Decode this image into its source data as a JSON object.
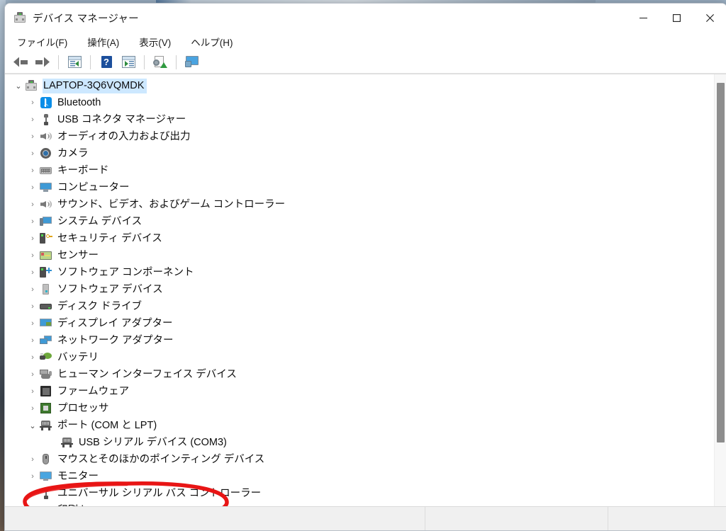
{
  "window": {
    "title": "デバイス マネージャー",
    "icon": "device-manager-icon",
    "controls": {
      "minimize": "—",
      "maximize": "□",
      "close": "✕"
    }
  },
  "menubar": {
    "items": [
      {
        "label": "ファイル(F)",
        "name": "menu-file"
      },
      {
        "label": "操作(A)",
        "name": "menu-action"
      },
      {
        "label": "表示(V)",
        "name": "menu-view"
      },
      {
        "label": "ヘルプ(H)",
        "name": "menu-help"
      }
    ]
  },
  "toolbar": {
    "buttons": [
      {
        "name": "back-button",
        "icon": "back-arrow-icon"
      },
      {
        "name": "forward-button",
        "icon": "forward-arrow-icon"
      },
      {
        "name": "show-hide-console-tree-button",
        "icon": "console-tree-icon"
      },
      {
        "name": "help-button",
        "icon": "help-question-icon"
      },
      {
        "name": "properties-button",
        "icon": "properties-pane-icon"
      },
      {
        "name": "scan-hardware-changes-button",
        "icon": "scan-hardware-icon"
      },
      {
        "name": "update-driver-button",
        "icon": "monitor-update-icon"
      }
    ]
  },
  "tree": {
    "root": {
      "label": "LAPTOP-3Q6VQMDK",
      "icon": "computer-root-icon",
      "expanded": true,
      "selected": true
    },
    "nodes": [
      {
        "label": "Bluetooth",
        "icon": "bluetooth-icon",
        "level": 1,
        "expanded": false
      },
      {
        "label": "USB コネクタ マネージャー",
        "icon": "usb-icon",
        "level": 1,
        "expanded": false
      },
      {
        "label": "オーディオの入力および出力",
        "icon": "speaker-icon",
        "level": 1,
        "expanded": false
      },
      {
        "label": "カメラ",
        "icon": "camera-icon",
        "level": 1,
        "expanded": false
      },
      {
        "label": "キーボード",
        "icon": "keyboard-icon",
        "level": 1,
        "expanded": false
      },
      {
        "label": "コンピューター",
        "icon": "computer-icon",
        "level": 1,
        "expanded": false
      },
      {
        "label": "サウンド、ビデオ、およびゲーム コントローラー",
        "icon": "speaker-icon",
        "level": 1,
        "expanded": false
      },
      {
        "label": "システム デバイス",
        "icon": "system-device-icon",
        "level": 1,
        "expanded": false
      },
      {
        "label": "セキュリティ デバイス",
        "icon": "security-device-icon",
        "level": 1,
        "expanded": false
      },
      {
        "label": "センサー",
        "icon": "sensor-icon",
        "level": 1,
        "expanded": false
      },
      {
        "label": "ソフトウェア コンポーネント",
        "icon": "software-component-icon",
        "level": 1,
        "expanded": false
      },
      {
        "label": "ソフトウェア デバイス",
        "icon": "software-device-icon",
        "level": 1,
        "expanded": false
      },
      {
        "label": "ディスク ドライブ",
        "icon": "disk-drive-icon",
        "level": 1,
        "expanded": false
      },
      {
        "label": "ディスプレイ アダプター",
        "icon": "display-adapter-icon",
        "level": 1,
        "expanded": false
      },
      {
        "label": "ネットワーク アダプター",
        "icon": "network-adapter-icon",
        "level": 1,
        "expanded": false
      },
      {
        "label": "バッテリ",
        "icon": "battery-icon",
        "level": 1,
        "expanded": false
      },
      {
        "label": "ヒューマン インターフェイス デバイス",
        "icon": "hid-icon",
        "level": 1,
        "expanded": false
      },
      {
        "label": "ファームウェア",
        "icon": "firmware-icon",
        "level": 1,
        "expanded": false
      },
      {
        "label": "プロセッサ",
        "icon": "processor-icon",
        "level": 1,
        "expanded": false
      },
      {
        "label": "ポート (COM と LPT)",
        "icon": "port-icon",
        "level": 1,
        "expanded": true,
        "highlighted": true
      },
      {
        "label": "USB シリアル デバイス (COM3)",
        "icon": "port-icon",
        "level": 2,
        "expanded": false,
        "highlighted": true
      },
      {
        "label": "マウスとそのほかのポインティング デバイス",
        "icon": "mouse-icon",
        "level": 1,
        "expanded": false
      },
      {
        "label": "モニター",
        "icon": "monitor-icon",
        "level": 1,
        "expanded": false
      },
      {
        "label": "ユニバーサル シリアル バス コントローラー",
        "icon": "usb-icon",
        "level": 1,
        "expanded": false
      },
      {
        "label": "印刷キュー",
        "icon": "printer-icon",
        "level": 1,
        "expanded": false
      }
    ]
  },
  "annotation": {
    "type": "hand-drawn-ellipse",
    "color": "#e81515",
    "targets": [
      "ポート (COM と LPT)",
      "USB シリアル デバイス (COM3)"
    ]
  },
  "statusbar": {
    "pane1": "",
    "pane2": "",
    "pane3": ""
  },
  "colors": {
    "selection": "#cde8ff",
    "accent_blue": "#0b8ee8",
    "annotation_red": "#e81515",
    "window_bg": "#ffffff",
    "statusbar_bg": "#f0f0f0"
  },
  "scrollbar": {
    "orientation": "vertical",
    "thumb_position_percent": 2,
    "thumb_size_percent": 85
  }
}
